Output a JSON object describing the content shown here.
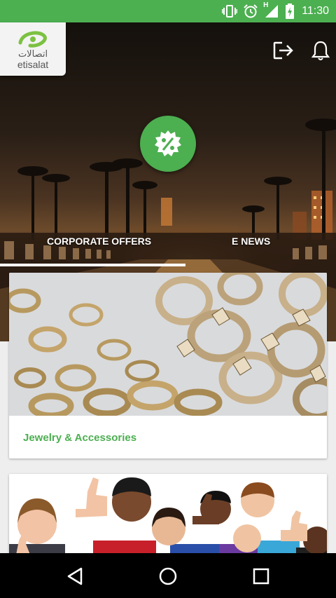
{
  "status_bar": {
    "time": "11:30",
    "icons": [
      "vibrate-icon",
      "alarm-icon",
      "signal-icon",
      "battery-charging-icon"
    ],
    "network_label": "H",
    "color": "#4caf50"
  },
  "brand": {
    "name_ar": "اتصالات",
    "name_en": "etisalat"
  },
  "header_actions": {
    "logout_icon": "logout-icon",
    "notifications_icon": "bell-icon"
  },
  "hero": {
    "offer_icon": "percent-badge-icon",
    "tabs": [
      {
        "label": "CORPORATE OFFERS",
        "selected": true
      },
      {
        "label": "E NEWS",
        "selected": false
      }
    ]
  },
  "categories": [
    {
      "title": "Jewelry & Accessories",
      "image": "gold-chains-image"
    },
    {
      "title": "",
      "image": "happy-kids-thumbs-up-image"
    }
  ],
  "nav_bar": {
    "back_icon": "back-triangle-icon",
    "home_icon": "home-circle-icon",
    "recents_icon": "recents-square-icon"
  },
  "accent": "#4caf50"
}
